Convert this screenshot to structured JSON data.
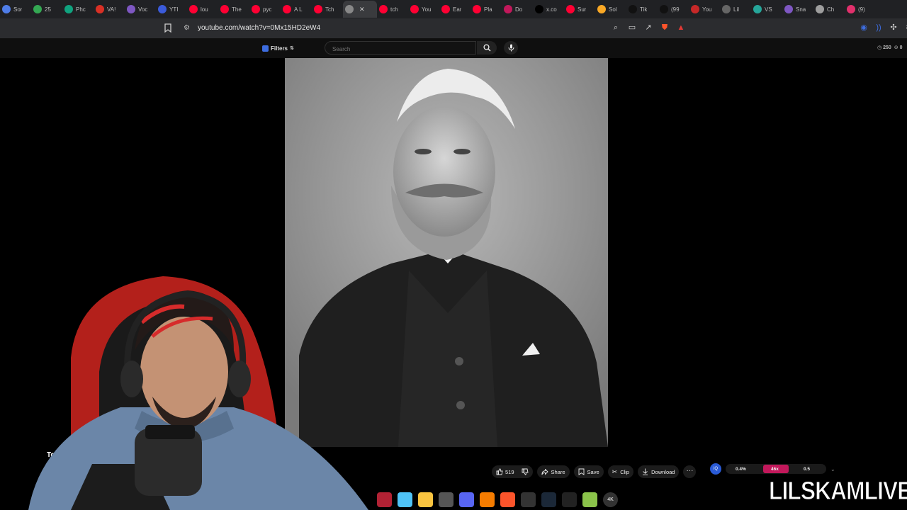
{
  "browser": {
    "tabs": [
      {
        "title": "Sor",
        "icon": "swirl-icon",
        "color": "#4f7de8"
      },
      {
        "title": "25",
        "icon": "drive-icon",
        "color": "#34a853"
      },
      {
        "title": "Phc",
        "icon": "chatgpt-icon",
        "color": "#10a37f"
      },
      {
        "title": "VA!",
        "icon": "vita-icon",
        "color": "#d93025"
      },
      {
        "title": "Voc",
        "icon": "voice-icon",
        "color": "#7e57c2"
      },
      {
        "title": "YTI",
        "icon": "ytboost-icon",
        "color": "#3b5bdb"
      },
      {
        "title": "lou",
        "icon": "youtube-icon",
        "color": "#ff0033"
      },
      {
        "title": "The",
        "icon": "youtube-icon",
        "color": "#ff0033"
      },
      {
        "title": "pyc",
        "icon": "youtube-icon",
        "color": "#ff0033"
      },
      {
        "title": "A L",
        "icon": "youtube-icon",
        "color": "#ff0033"
      },
      {
        "title": "Tch",
        "icon": "youtube-icon",
        "color": "#ff0033"
      },
      {
        "title": "",
        "icon": "speaker-icon",
        "color": "#888888",
        "active": true
      },
      {
        "title": "tch",
        "icon": "youtube-icon",
        "color": "#ff0033"
      },
      {
        "title": "You",
        "icon": "youtube-icon",
        "color": "#ff0033"
      },
      {
        "title": "Ear",
        "icon": "youtube-icon",
        "color": "#ff0033"
      },
      {
        "title": "Pla",
        "icon": "youtube-icon",
        "color": "#ff0033"
      },
      {
        "title": "Do",
        "icon": "d-icon",
        "color": "#c2185b"
      },
      {
        "title": "x.co",
        "icon": "x-icon",
        "color": "#000000"
      },
      {
        "title": "Sur",
        "icon": "youtube-icon",
        "color": "#ff0033"
      },
      {
        "title": "Sol",
        "icon": "coin-icon",
        "color": "#f9a825"
      },
      {
        "title": "Tik",
        "icon": "tiktok-icon",
        "color": "#111111"
      },
      {
        "title": "(99",
        "icon": "tiktok-icon",
        "color": "#111111"
      },
      {
        "title": "You",
        "icon": "record-icon",
        "color": "#c62828"
      },
      {
        "title": "Lil",
        "icon": "globe-icon",
        "color": "#666666"
      },
      {
        "title": "VS",
        "icon": "vs-icon",
        "color": "#26a69a"
      },
      {
        "title": "Sna",
        "icon": "sna-icon",
        "color": "#7e57c2"
      },
      {
        "title": "Ch",
        "icon": "chrome-icon",
        "color": "#9e9e9e"
      },
      {
        "title": "(9)",
        "icon": "instagram-icon",
        "color": "#e1306c"
      }
    ],
    "close_glyph": "✕",
    "url": "youtube.com/watch?v=0Mx15HD2eW4"
  },
  "youtube": {
    "filters_label": "Filters",
    "search_placeholder": "Search",
    "counter_a": "250",
    "counter_b": "0",
    "video_title_stub": "Tche",
    "like_count": "519",
    "share_label": "Share",
    "save_label": "Save",
    "clip_label": "Clip",
    "download_label": "Download",
    "more_glyph": "···",
    "speed": {
      "left": "0.4%",
      "middle": "46x",
      "right": "0.5",
      "accent": "#c2185b",
      "badge": "iQ"
    }
  },
  "taskbar": {
    "items": [
      {
        "name": "flag-icon",
        "color": "#b22234"
      },
      {
        "name": "copilot-icon",
        "color": "#4fc3f7"
      },
      {
        "name": "folder-icon",
        "color": "#f9c440"
      },
      {
        "name": "calculator-icon",
        "color": "#555555"
      },
      {
        "name": "discord-icon",
        "color": "#5865f2"
      },
      {
        "name": "shield-icon",
        "color": "#f57c00"
      },
      {
        "name": "brave-icon",
        "color": "#fb542b"
      },
      {
        "name": "obs-icon",
        "color": "#333333"
      },
      {
        "name": "steam-icon",
        "color": "#1b2838"
      },
      {
        "name": "app-icon",
        "color": "#222222"
      },
      {
        "name": "layers-icon",
        "color": "#8bc34a"
      },
      {
        "name": "4k-icon",
        "color": "#333333"
      }
    ],
    "fourk_label": "4K"
  },
  "overlay": {
    "channel_name": "LILSKAMLIVE"
  }
}
